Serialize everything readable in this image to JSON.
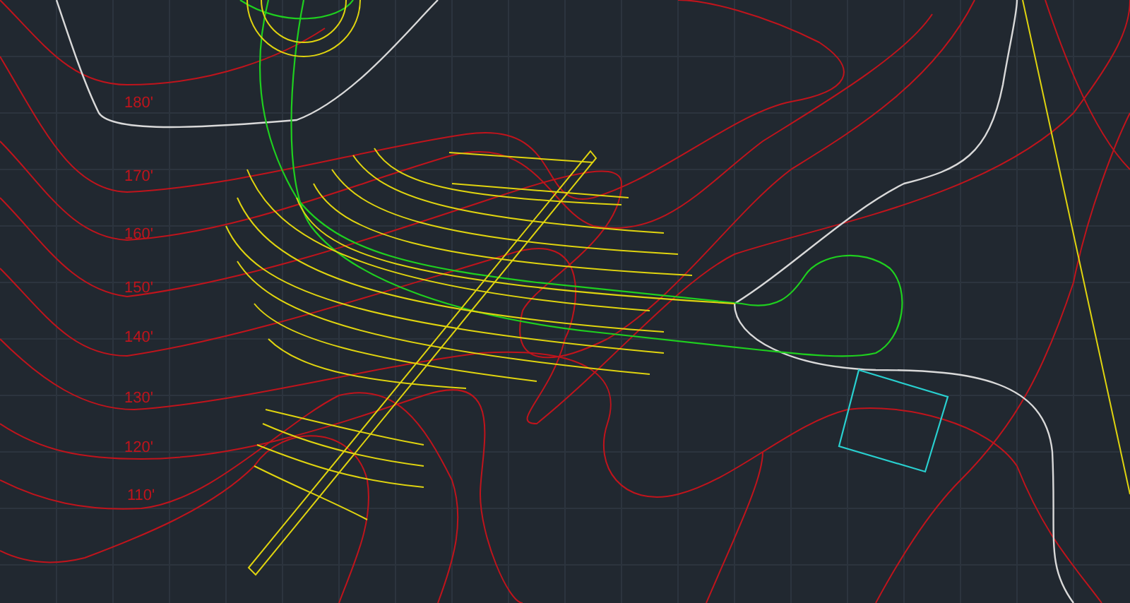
{
  "elevation_labels": [
    "180'",
    "170'",
    "160'",
    "150'",
    "140'",
    "130'",
    "120'",
    "110'"
  ]
}
